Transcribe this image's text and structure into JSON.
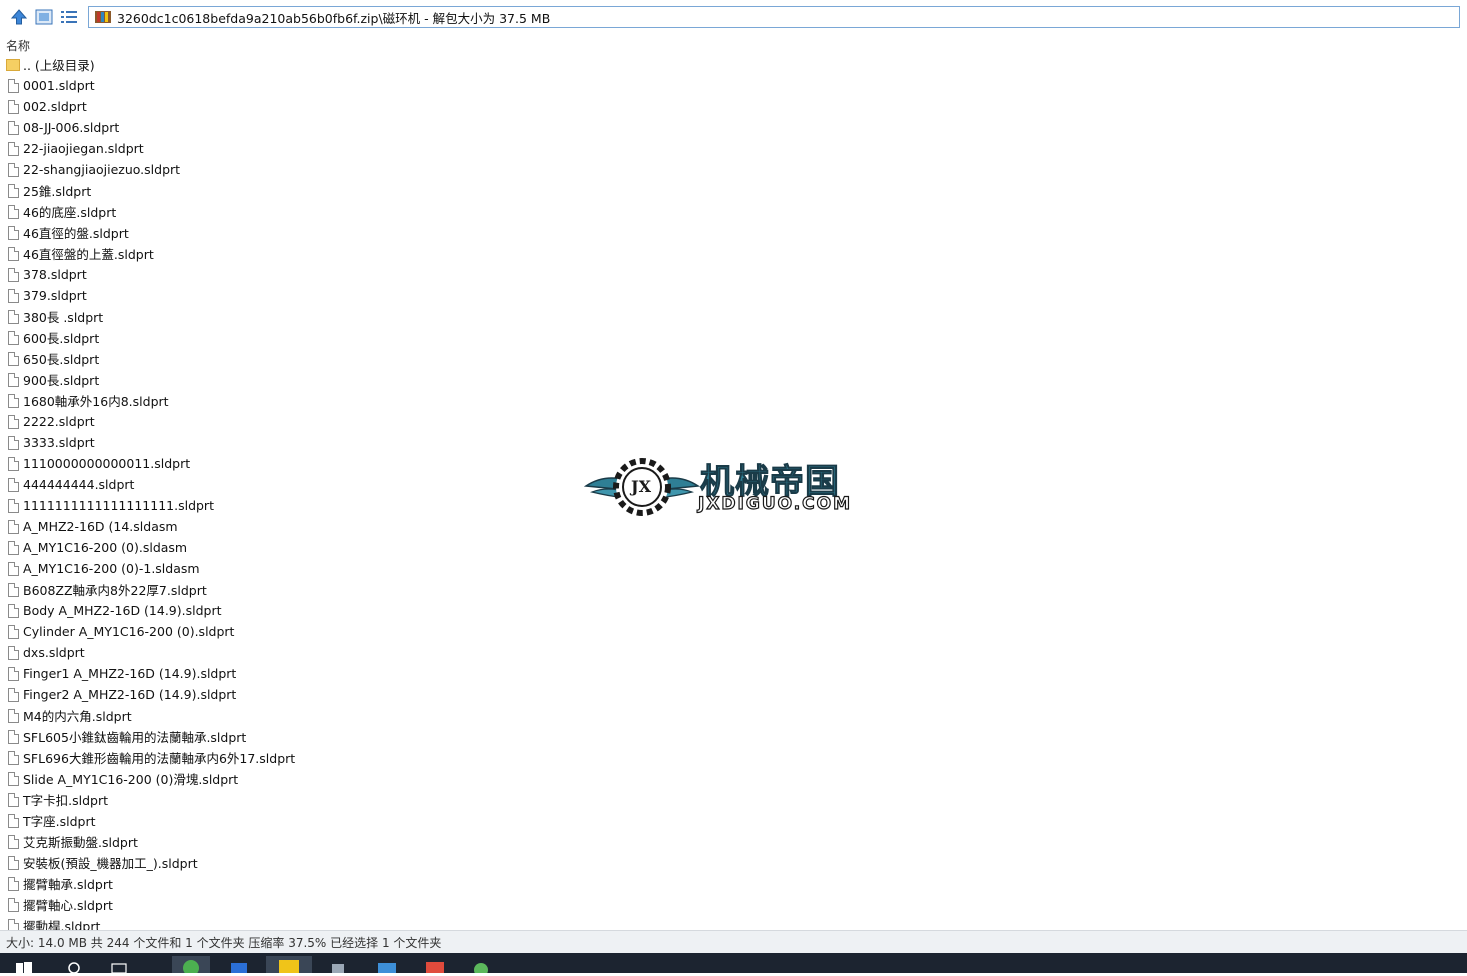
{
  "toolbar": {
    "up_icon": "up-arrow-icon",
    "view_icon": "thumbnail-view-icon",
    "list_icon": "details-list-icon"
  },
  "address": {
    "icon": "winrar-archive-icon",
    "path": "3260dc1c0618befda9a210ab56b0fb6f.zip\\磁环机 - 解包大小为 37.5 MB"
  },
  "columns": {
    "name": "名称"
  },
  "files": [
    {
      "name": ".. (上级目录)",
      "type": "folder"
    },
    {
      "name": "0001.sldprt",
      "type": "file"
    },
    {
      "name": "002.sldprt",
      "type": "file"
    },
    {
      "name": "08-JJ-006.sldprt",
      "type": "file"
    },
    {
      "name": "22-jiaojiegan.sldprt",
      "type": "file"
    },
    {
      "name": "22-shangjiaojiezuo.sldprt",
      "type": "file"
    },
    {
      "name": "25錐.sldprt",
      "type": "file"
    },
    {
      "name": "46的底座.sldprt",
      "type": "file"
    },
    {
      "name": "46直徑的盤.sldprt",
      "type": "file"
    },
    {
      "name": "46直徑盤的上蓋.sldprt",
      "type": "file"
    },
    {
      "name": "378.sldprt",
      "type": "file"
    },
    {
      "name": "379.sldprt",
      "type": "file"
    },
    {
      "name": "380長 .sldprt",
      "type": "file"
    },
    {
      "name": "600長.sldprt",
      "type": "file"
    },
    {
      "name": "650長.sldprt",
      "type": "file"
    },
    {
      "name": "900長.sldprt",
      "type": "file"
    },
    {
      "name": "1680軸承外16内8.sldprt",
      "type": "file"
    },
    {
      "name": "2222.sldprt",
      "type": "file"
    },
    {
      "name": "3333.sldprt",
      "type": "file"
    },
    {
      "name": "1110000000000011.sldprt",
      "type": "file"
    },
    {
      "name": "444444444.sldprt",
      "type": "file"
    },
    {
      "name": "1111111111111111111.sldprt",
      "type": "file"
    },
    {
      "name": "A_MHZ2-16D (14.sldasm",
      "type": "file"
    },
    {
      "name": "A_MY1C16-200 (0).sldasm",
      "type": "file"
    },
    {
      "name": "A_MY1C16-200 (0)-1.sldasm",
      "type": "file"
    },
    {
      "name": "B608ZZ軸承内8外22厚7.sldprt",
      "type": "file"
    },
    {
      "name": "Body A_MHZ2-16D (14.9).sldprt",
      "type": "file"
    },
    {
      "name": "Cylinder A_MY1C16-200 (0).sldprt",
      "type": "file"
    },
    {
      "name": "dxs.sldprt",
      "type": "file"
    },
    {
      "name": "Finger1 A_MHZ2-16D (14.9).sldprt",
      "type": "file"
    },
    {
      "name": "Finger2 A_MHZ2-16D (14.9).sldprt",
      "type": "file"
    },
    {
      "name": "M4的内六角.sldprt",
      "type": "file"
    },
    {
      "name": "SFL605小錐鈦齒輪用的法蘭軸承.sldprt",
      "type": "file"
    },
    {
      "name": "SFL696大錐形齒輪用的法蘭軸承内6外17.sldprt",
      "type": "file"
    },
    {
      "name": "Slide A_MY1C16-200 (0)滑塊.sldprt",
      "type": "file"
    },
    {
      "name": "T字卡扣.sldprt",
      "type": "file"
    },
    {
      "name": "T字座.sldprt",
      "type": "file"
    },
    {
      "name": "艾克斯振動盤.sldprt",
      "type": "file"
    },
    {
      "name": "安裝板(預設_機器加工_).sldprt",
      "type": "file"
    },
    {
      "name": "擺臂軸承.sldprt",
      "type": "file"
    },
    {
      "name": "擺臂軸心.sldprt",
      "type": "file"
    },
    {
      "name": "擺動桿.sldprt",
      "type": "file"
    }
  ],
  "watermark": {
    "cn": "机械帝国",
    "en": "JXDIGUO.COM",
    "badge": "JX"
  },
  "status": {
    "text": "大小: 14.0 MB 共 244 个文件和 1 个文件夹 压缩率 37.5% 已经选择 1 个文件夹"
  },
  "colors": {
    "accent": "#2f7f95",
    "folder": "#f5cf63",
    "statusbar": "#eef1f4",
    "taskbar": "#1c2430"
  }
}
